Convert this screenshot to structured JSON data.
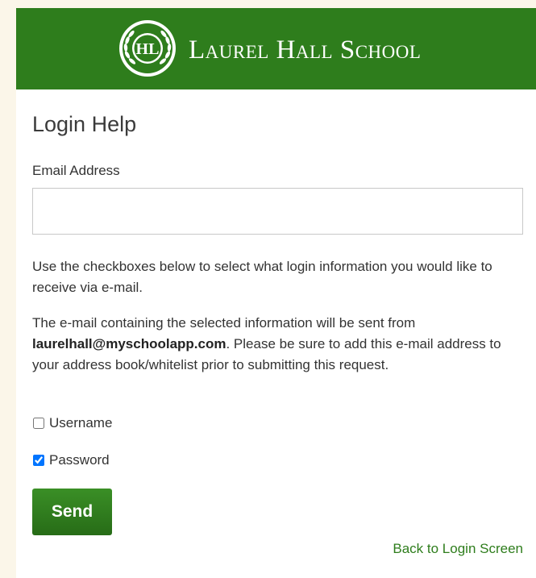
{
  "header": {
    "logo_monogram": "HL",
    "school_name": "Laurel Hall School"
  },
  "form": {
    "title": "Login Help",
    "email_label": "Email Address",
    "email_value": "",
    "email_placeholder": "",
    "instruction": "Use the checkboxes below to select what login information you would like to receive via e-mail.",
    "notice_before": "The e-mail containing the selected information will be sent from ",
    "notice_email": "laurelhall@myschoolapp.com",
    "notice_after": ". Please be sure to add this e-mail address to your address book/whitelist prior to submitting this request.",
    "options": [
      {
        "label": "Username",
        "checked": false
      },
      {
        "label": "Password",
        "checked": true
      }
    ],
    "send_label": "Send",
    "back_link_label": "Back to Login Screen"
  },
  "colors": {
    "brand_green": "#2e7d1c",
    "page_background": "#fbf6e9",
    "text": "#333333"
  },
  "icons": {
    "crest": "laurel-wreath-crest-icon"
  }
}
